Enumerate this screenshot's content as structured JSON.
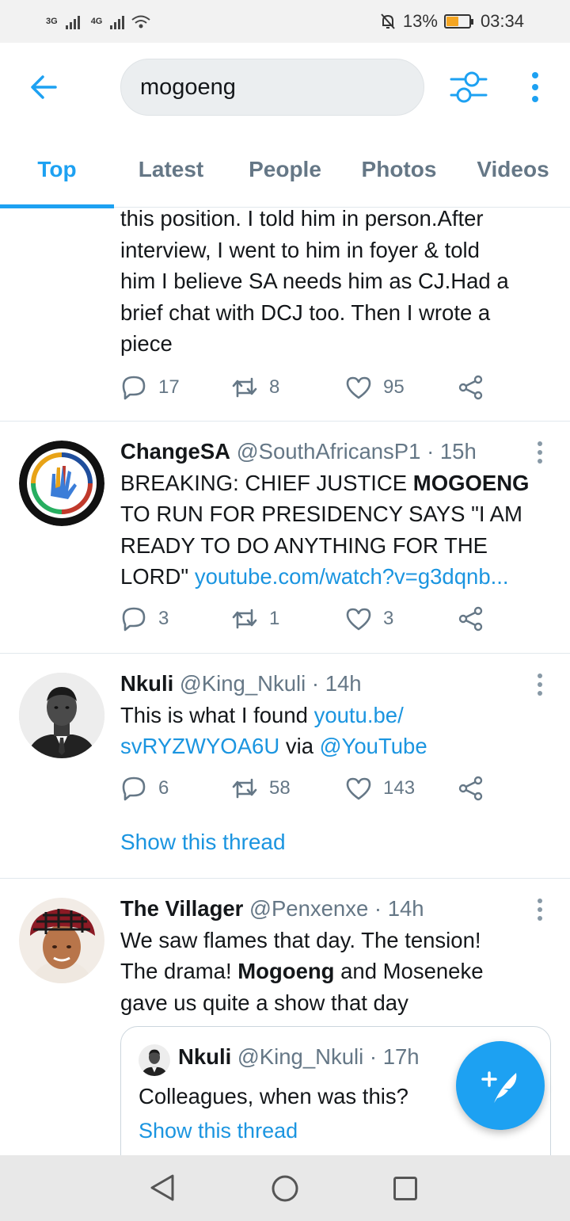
{
  "status_bar": {
    "network_1": "3G",
    "network_2": "4G",
    "battery": "13%",
    "battery_level": 0.13,
    "time": "03:34"
  },
  "search": {
    "query": "mogoeng"
  },
  "tabs": [
    {
      "label": "Top",
      "active": true
    },
    {
      "label": "Latest"
    },
    {
      "label": "People"
    },
    {
      "label": "Photos"
    },
    {
      "label": "Videos"
    }
  ],
  "tweets": [
    {
      "lines": [
        "this position. I told him in person.After",
        "interview, I went to him in foyer & told",
        "him I believe SA needs him as CJ.Had a",
        "brief chat with DCJ too. Then I wrote a",
        "piece"
      ],
      "replies": "17",
      "retweets": "8",
      "likes": "95"
    },
    {
      "name": "ChangeSA",
      "handle": "@SouthAfricansP1",
      "time": "· 15h",
      "line1_pre": "BREAKING: CHIEF JUSTICE ",
      "line1_bold": "MOGOENG",
      "line2": "TO RUN FOR PRESIDENCY SAYS \"I AM",
      "line3": "READY TO DO ANYTHING FOR THE",
      "line4_pre": "LORD\" ",
      "line4_link": "youtube.com/watch?v=g3dqnb...",
      "replies": "3",
      "retweets": "1",
      "likes": "3"
    },
    {
      "name": "Nkuli",
      "handle": "@King_Nkuli",
      "time": "· 14h",
      "line1_pre": "This is what I found ",
      "line1_link": "youtu.be/",
      "line2_link": "svRYZWYOA6U",
      "line2_mid": " via ",
      "line2_mention": "@YouTube",
      "replies": "6",
      "retweets": "58",
      "likes": "143",
      "show_thread": "Show this thread"
    },
    {
      "name": "The Villager",
      "handle": "@Penxenxe",
      "time": "· 14h",
      "line1": "We saw flames that day. The tension!",
      "line2_pre": "The drama! ",
      "line2_bold": "Mogoeng",
      "line2_post": " and Moseneke",
      "line3": "gave us quite a show that day",
      "quote": {
        "name": "Nkuli",
        "handle": "@King_Nkuli",
        "time": "· 17h",
        "text": "Colleagues, when was this?",
        "show_thread": "Show this thread"
      }
    }
  ]
}
